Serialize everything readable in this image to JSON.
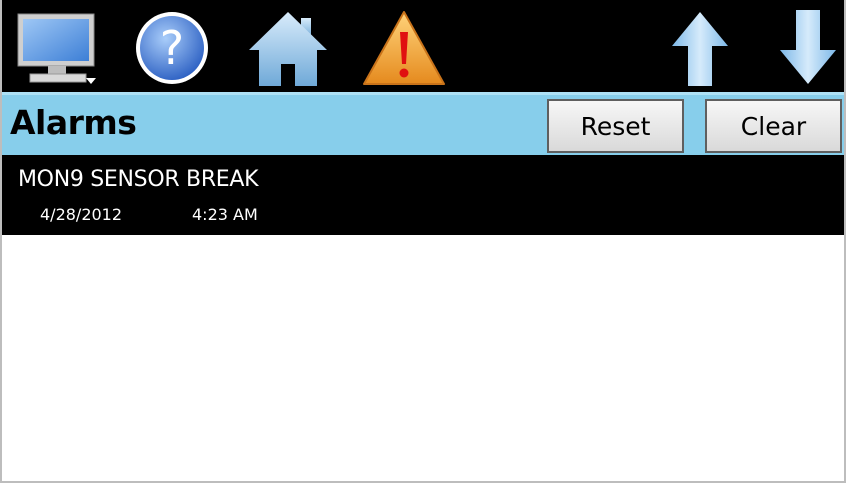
{
  "toolbar": {
    "icons": [
      "monitor-icon",
      "help-icon",
      "home-icon",
      "alarm-warning-icon",
      "arrow-up-icon",
      "arrow-down-icon"
    ]
  },
  "header": {
    "title": "Alarms",
    "reset_label": "Reset",
    "clear_label": "Clear"
  },
  "alarms": [
    {
      "name": "MON9 SENSOR BREAK",
      "date": "4/28/2012",
      "time": "4:23 AM"
    }
  ],
  "colors": {
    "toolbar_bg": "#000000",
    "title_bar_bg": "#87ceeb",
    "alarm_row_bg": "#000000",
    "alarm_text": "#ffffff"
  }
}
